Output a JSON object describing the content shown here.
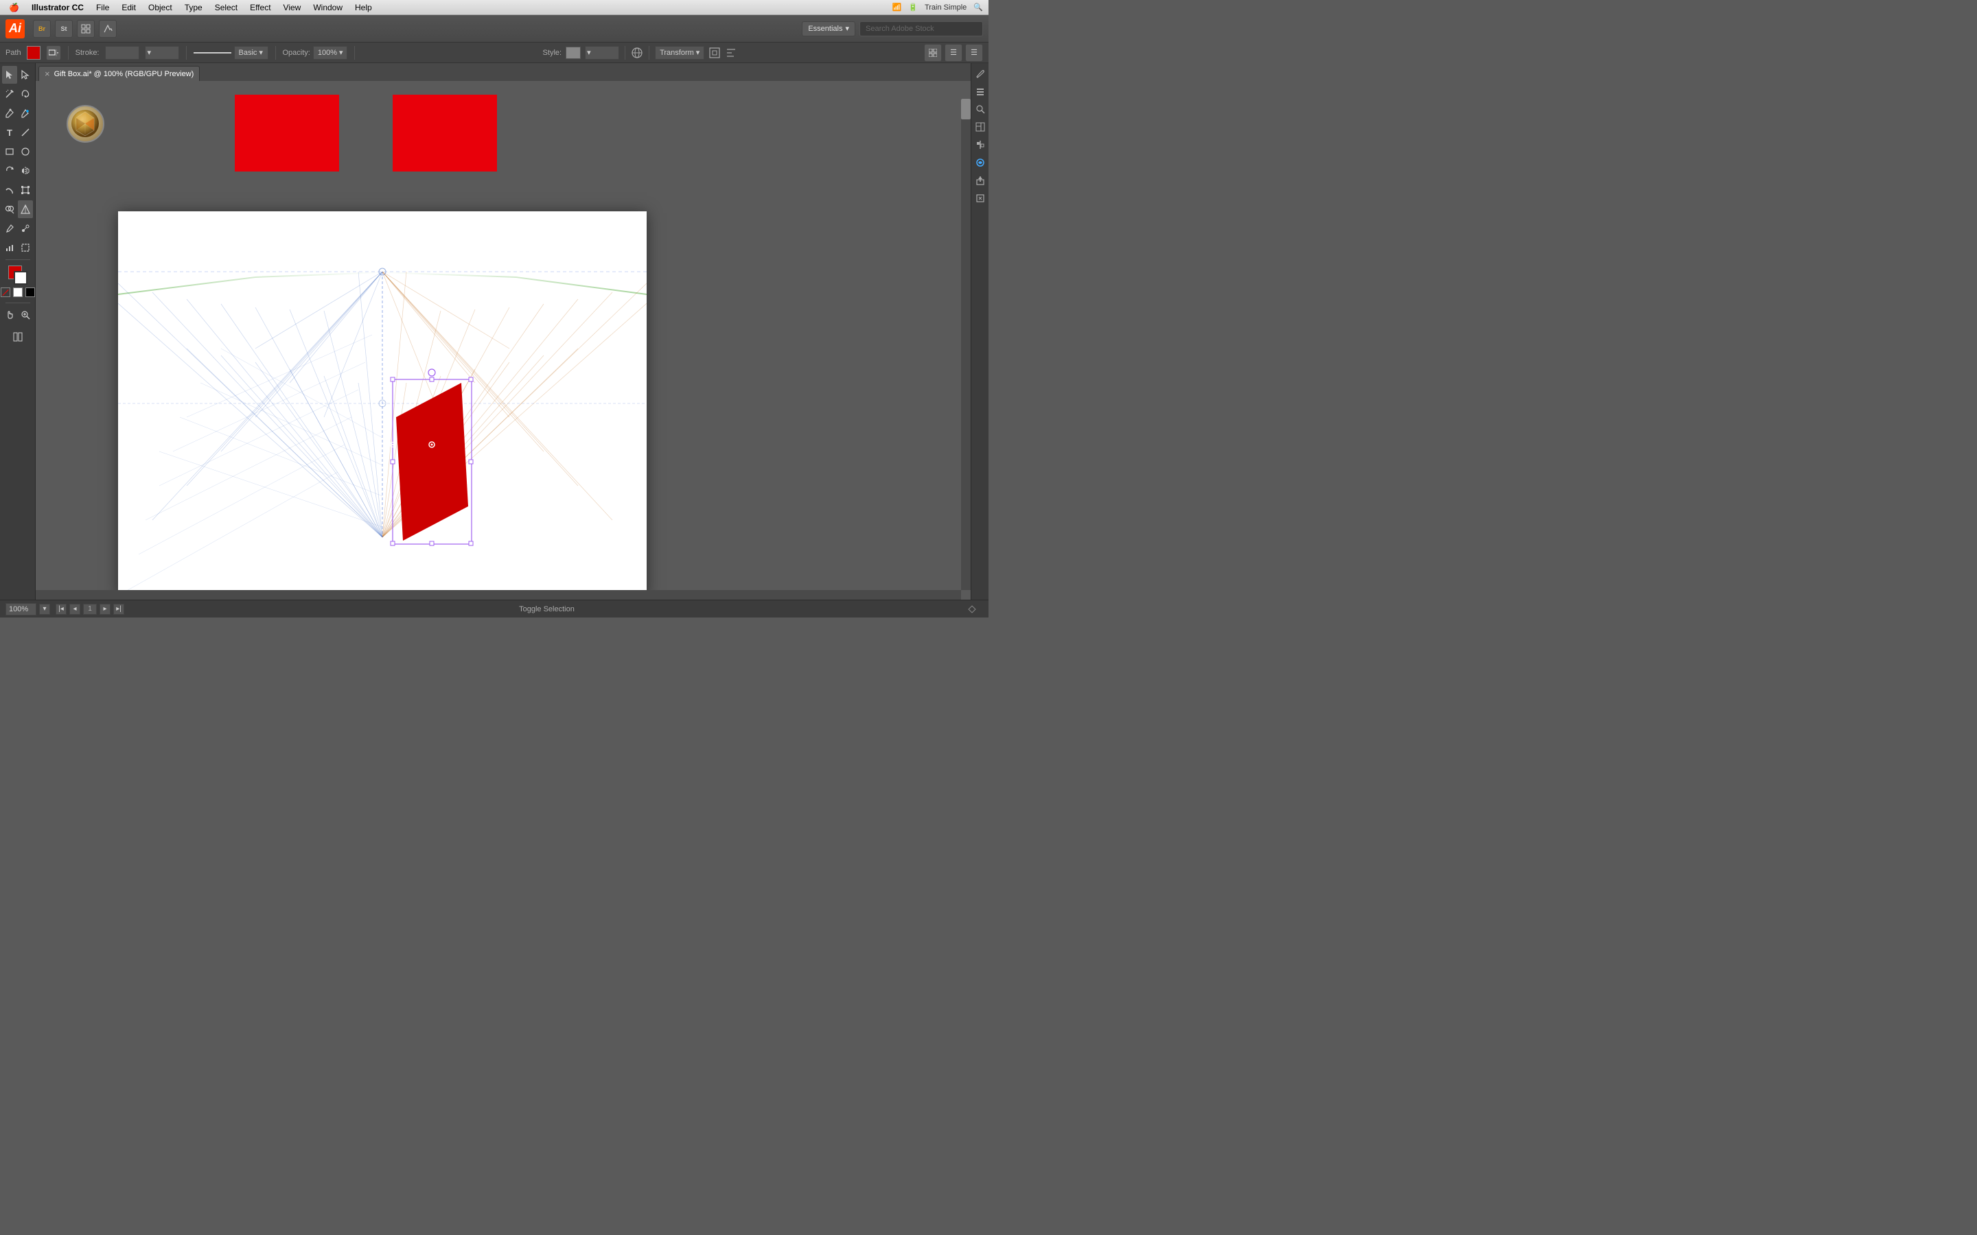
{
  "menubar": {
    "apple": "⌘",
    "app_name": "Illustrator CC",
    "menus": [
      "File",
      "Edit",
      "Object",
      "Type",
      "Select",
      "Effect",
      "View",
      "Window",
      "Help"
    ],
    "right": {
      "wifi": "WiFi",
      "battery": "Battery",
      "time": "Train Simple"
    }
  },
  "app_toolbar": {
    "logo_text": "Ai",
    "essentials_label": "Essentials",
    "search_placeholder": "Search Adobe Stock"
  },
  "properties_bar": {
    "path_label": "Path",
    "fill_color": "#cc0000",
    "stroke_label": "Stroke:",
    "stroke_value": "",
    "line_style": "Basic",
    "opacity_label": "Opacity:",
    "opacity_value": "100%",
    "style_label": "Style:",
    "transform_label": "Transform"
  },
  "tab": {
    "close_icon": "×",
    "title": "Gift Box.ai* @ 100% (RGB/GPU Preview)"
  },
  "canvas": {
    "zoom": "100%",
    "artboard_number": "1",
    "status": "Toggle Selection"
  },
  "tools": {
    "list": [
      {
        "name": "selection-tool",
        "icon": "▶"
      },
      {
        "name": "direct-selection-tool",
        "icon": "↗"
      },
      {
        "name": "magic-wand-tool",
        "icon": "✦"
      },
      {
        "name": "lasso-tool",
        "icon": "⌒"
      },
      {
        "name": "pen-tool",
        "icon": "✒"
      },
      {
        "name": "add-anchor-tool",
        "icon": "+"
      },
      {
        "name": "type-tool",
        "icon": "T"
      },
      {
        "name": "line-tool",
        "icon": "/"
      },
      {
        "name": "rect-tool",
        "icon": "□"
      },
      {
        "name": "ellipse-tool",
        "icon": "○"
      },
      {
        "name": "rotate-tool",
        "icon": "↻"
      },
      {
        "name": "scale-tool",
        "icon": "⤢"
      },
      {
        "name": "warp-tool",
        "icon": "〜"
      },
      {
        "name": "free-transform-tool",
        "icon": "⊡"
      },
      {
        "name": "shape-builder-tool",
        "icon": "⊕"
      },
      {
        "name": "perspective-grid-tool",
        "icon": "⊞"
      },
      {
        "name": "eyedropper-tool",
        "icon": "🖊"
      },
      {
        "name": "blend-tool",
        "icon": "⊗"
      },
      {
        "name": "chart-tool",
        "icon": "📊"
      },
      {
        "name": "artboard-tool",
        "icon": "⊠"
      },
      {
        "name": "hand-tool",
        "icon": "✋"
      },
      {
        "name": "zoom-tool",
        "icon": "🔍"
      }
    ]
  },
  "right_panel": {
    "icons": [
      "brush",
      "layers",
      "search",
      "panels",
      "align",
      "cloud",
      "export",
      "embed"
    ]
  }
}
